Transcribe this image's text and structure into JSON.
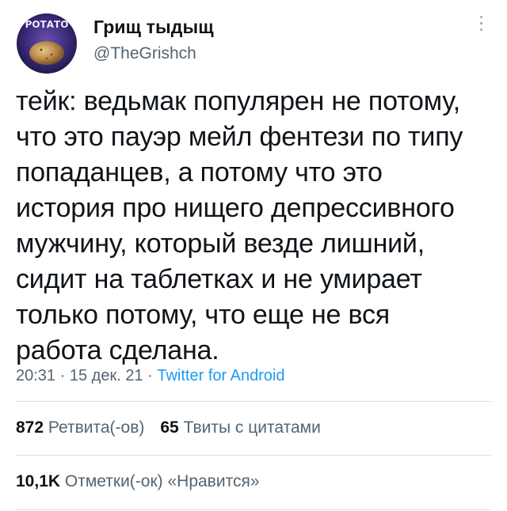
{
  "author": {
    "display_name": "Грищ тыдыщ",
    "handle": "@TheGrishch",
    "avatar_caption": "РОТАТО"
  },
  "tweet": {
    "text": "тейк: ведьмак популярен не потому,\nчто это пауэр мейл фентези по типу\nпопаданцев, а потому что это\nистория про нищего депрессивного\nмужчину, который везде лишний,\nсидит на таблетках и не умирает\nтолько потому, что еще не вся\nработа сделана.",
    "time": "20:31",
    "date": "15 дек. 21",
    "separator": "·",
    "source": "Twitter for Android"
  },
  "stats": {
    "retweets_count": "872",
    "retweets_label": "Ретвита(-ов)",
    "quotes_count": "65",
    "quotes_label": "Твиты с цитатами",
    "likes_count": "10,1K",
    "likes_label": "Отметки(-ок) «Нравится»"
  },
  "colors": {
    "text": "#0f1419",
    "secondary": "#536471",
    "link": "#1d9bf0",
    "divider": "#d9dee2"
  },
  "icons": {
    "more": "more-vertical-icon"
  }
}
